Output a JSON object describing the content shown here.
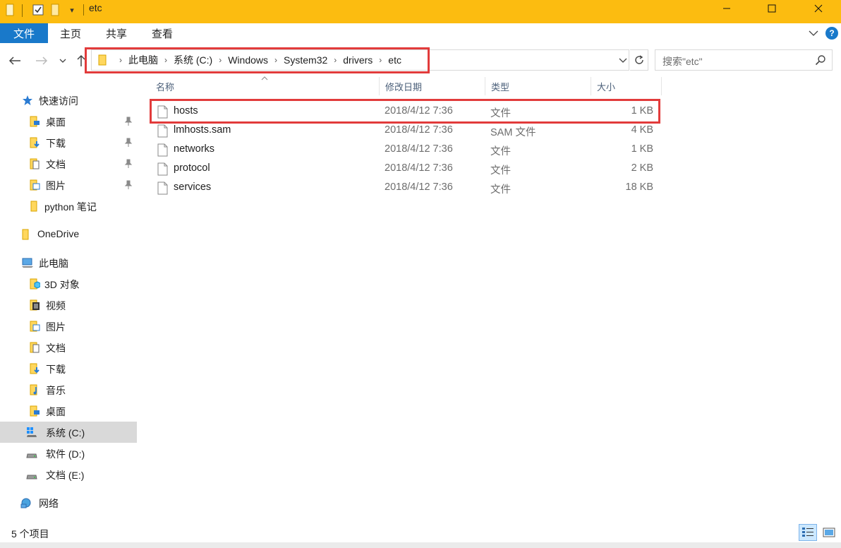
{
  "window": {
    "title": "etc",
    "accent_color": "#fcbc10",
    "quick_access_dropdown": "▾"
  },
  "ribbon": {
    "tabs": [
      {
        "label": "文件"
      },
      {
        "label": "主页"
      },
      {
        "label": "共享"
      },
      {
        "label": "查看"
      }
    ],
    "help_label": "?"
  },
  "navigation": {
    "breadcrumbs": [
      {
        "label": "此电脑"
      },
      {
        "label": "系统 (C:)"
      },
      {
        "label": "Windows"
      },
      {
        "label": "System32"
      },
      {
        "label": "drivers"
      },
      {
        "label": "etc"
      }
    ],
    "crumb_separator": "›",
    "search_placeholder": "搜索\"etc\""
  },
  "sidebar": {
    "items": [
      {
        "label": "快速访问",
        "icon": "star-icon"
      },
      {
        "label": "桌面",
        "icon": "desktop-folder-icon",
        "pinned": true
      },
      {
        "label": "下载",
        "icon": "download-folder-icon",
        "pinned": true
      },
      {
        "label": "文档",
        "icon": "documents-folder-icon",
        "pinned": true
      },
      {
        "label": "图片",
        "icon": "pictures-folder-icon",
        "pinned": true
      },
      {
        "label": "python 笔记",
        "icon": "folder-icon"
      },
      {
        "label": "OneDrive",
        "icon": "folder-icon"
      },
      {
        "label": "此电脑",
        "icon": "computer-icon"
      },
      {
        "label": "3D 对象",
        "icon": "3d-objects-folder-icon"
      },
      {
        "label": "视频",
        "icon": "videos-folder-icon"
      },
      {
        "label": "图片",
        "icon": "pictures-folder-icon"
      },
      {
        "label": "文档",
        "icon": "documents-folder-icon"
      },
      {
        "label": "下载",
        "icon": "download-folder-icon"
      },
      {
        "label": "音乐",
        "icon": "music-folder-icon"
      },
      {
        "label": "桌面",
        "icon": "desktop-folder-icon"
      },
      {
        "label": "系统 (C:)",
        "icon": "system-drive-icon",
        "selected": true
      },
      {
        "label": "软件 (D:)",
        "icon": "drive-icon"
      },
      {
        "label": "文档 (E:)",
        "icon": "drive-icon"
      },
      {
        "label": "网络",
        "icon": "network-icon"
      }
    ]
  },
  "file_list": {
    "columns": [
      {
        "label": "名称"
      },
      {
        "label": "修改日期"
      },
      {
        "label": "类型"
      },
      {
        "label": "大小"
      }
    ],
    "files": [
      {
        "name": "hosts",
        "modified": "2018/4/12 7:36",
        "type": "文件",
        "size": "1 KB",
        "highlighted": true
      },
      {
        "name": "lmhosts.sam",
        "modified": "2018/4/12 7:36",
        "type": "SAM 文件",
        "size": "4 KB"
      },
      {
        "name": "networks",
        "modified": "2018/4/12 7:36",
        "type": "文件",
        "size": "1 KB"
      },
      {
        "name": "protocol",
        "modified": "2018/4/12 7:36",
        "type": "文件",
        "size": "2 KB"
      },
      {
        "name": "services",
        "modified": "2018/4/12 7:36",
        "type": "文件",
        "size": "18 KB"
      }
    ]
  },
  "statusbar": {
    "item_count": "5 个项目"
  }
}
